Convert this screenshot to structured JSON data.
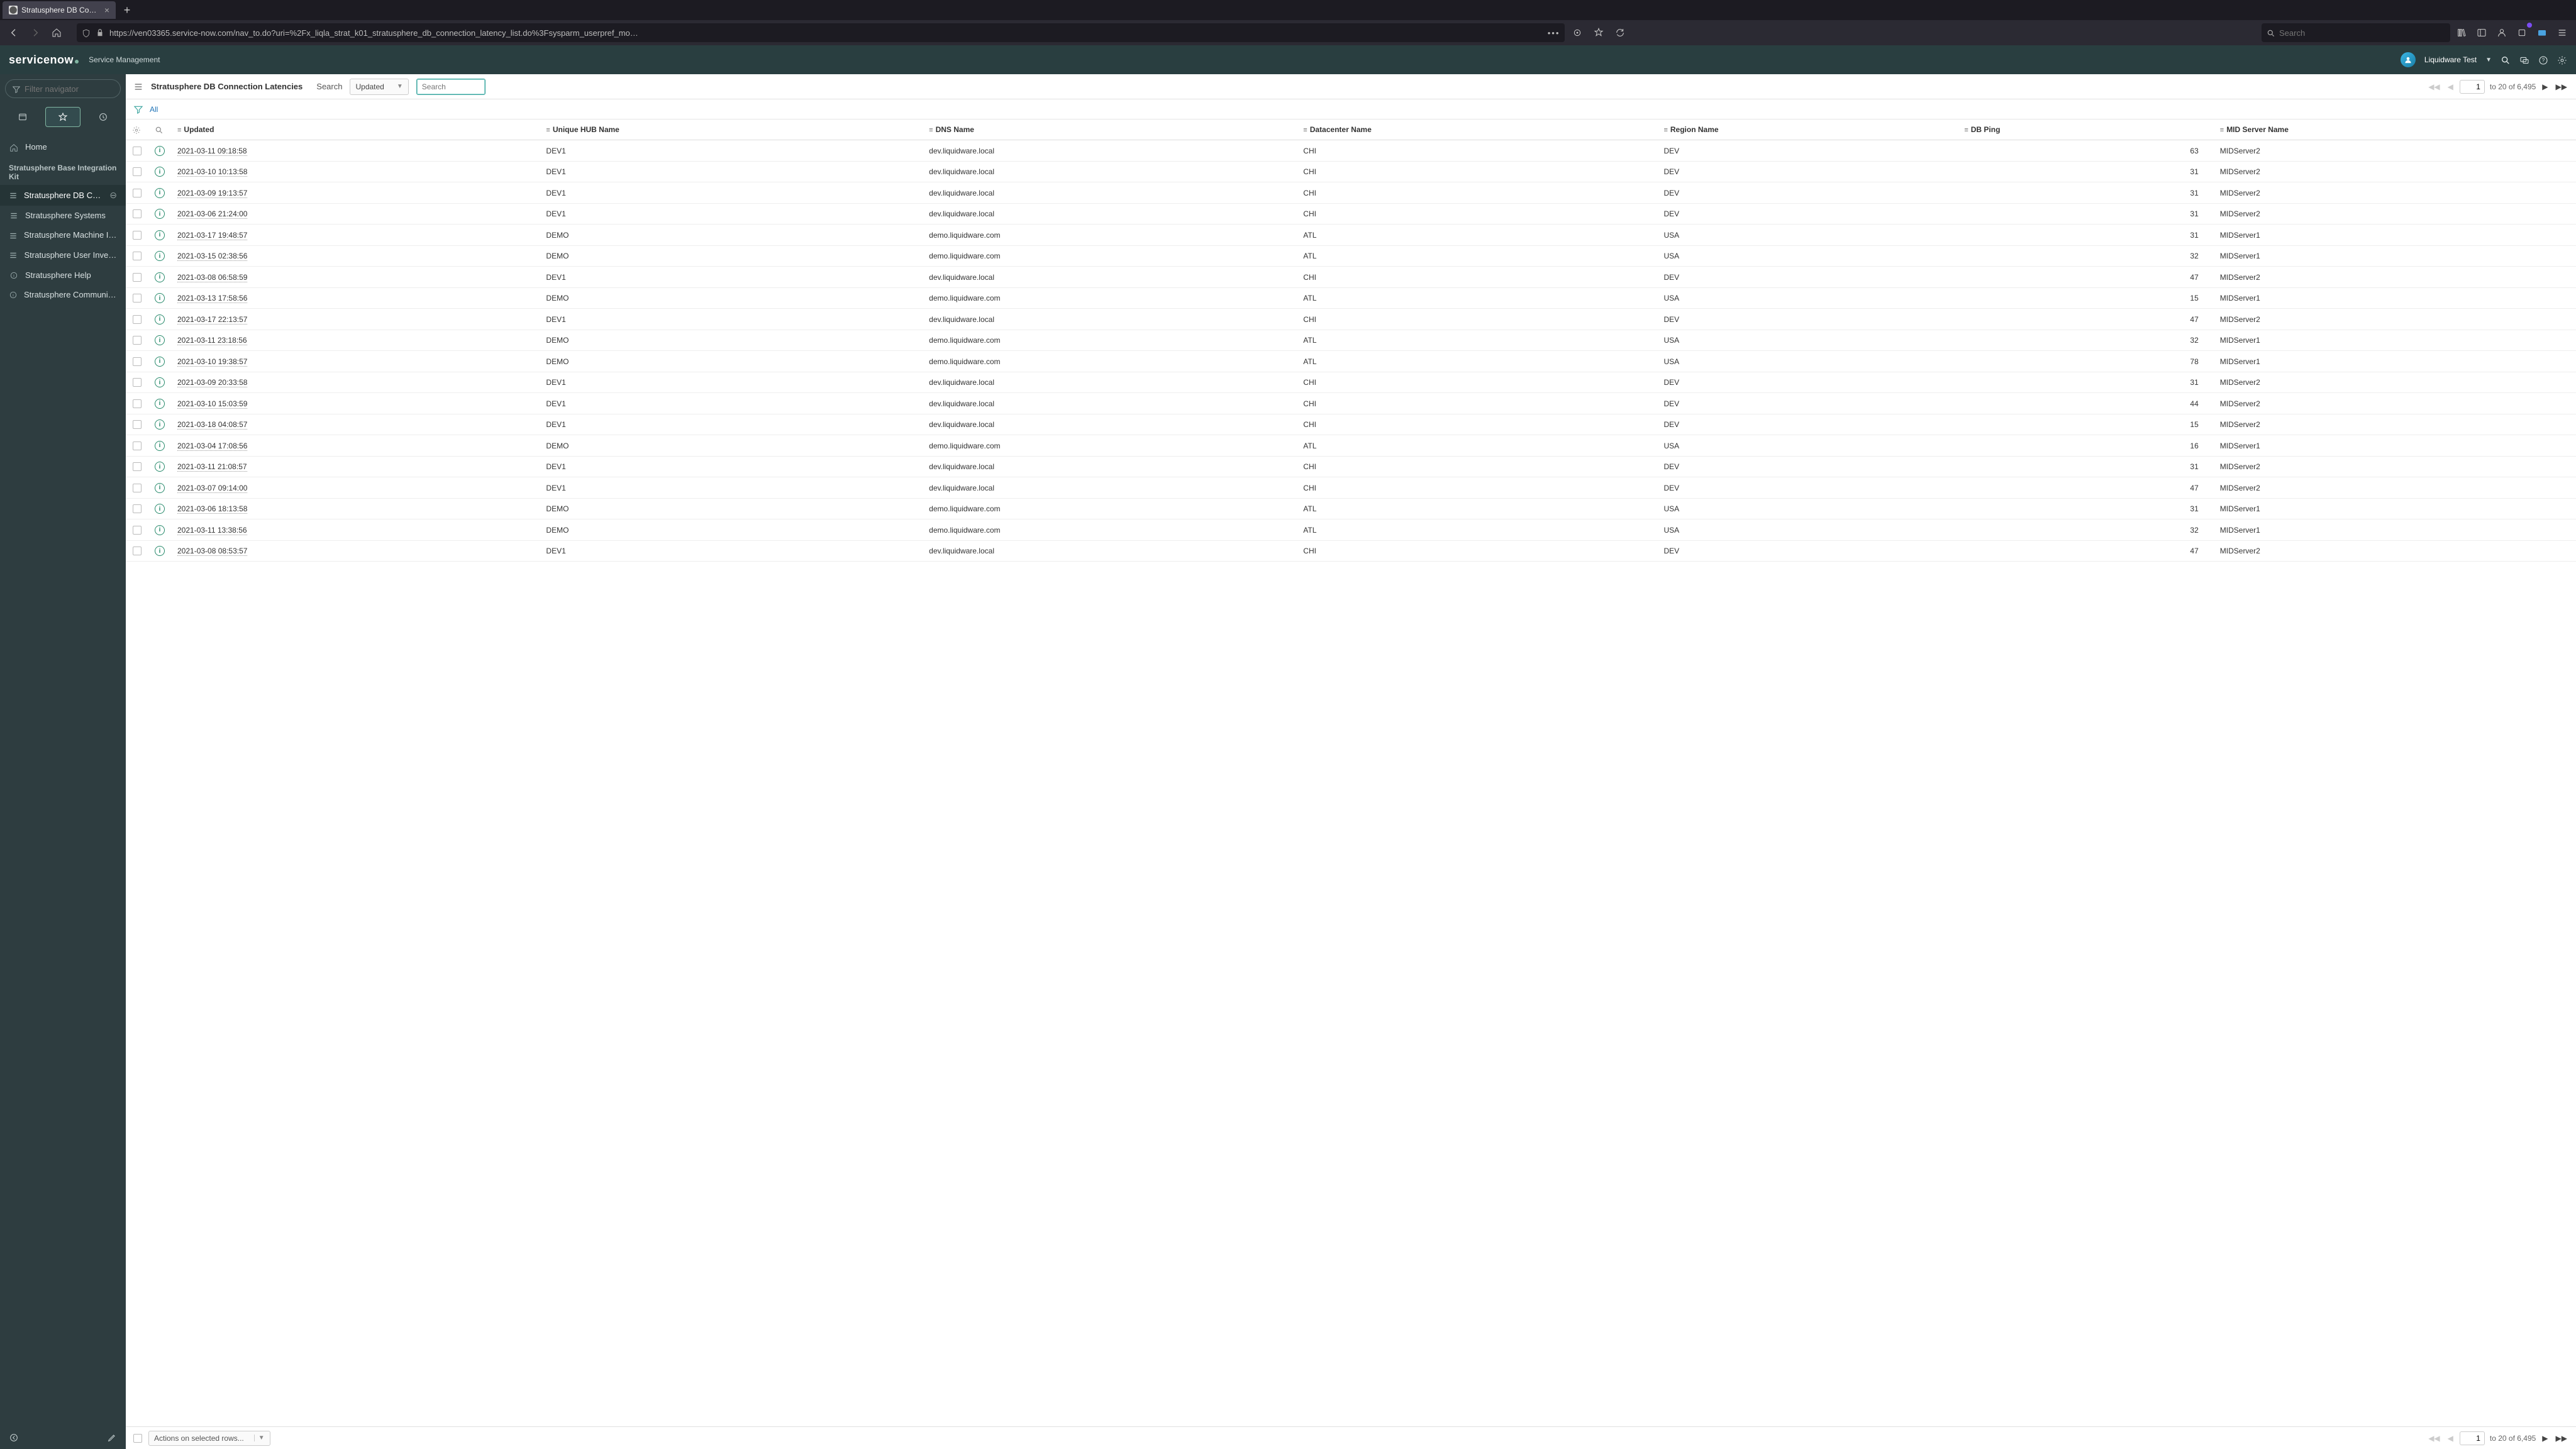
{
  "browser": {
    "tab_title": "Stratusphere DB Connection La…",
    "new_tab": "+",
    "address": "https://ven03365.service-now.com/nav_to.do?uri=%2Fx_liqla_strat_k01_stratusphere_db_connection_latency_list.do%3Fsysparm_userpref_mo…",
    "search_placeholder": "Search"
  },
  "banner": {
    "product": "servicenow",
    "suffix": "Service Management",
    "user": "Liquidware Test"
  },
  "leftnav": {
    "filter_placeholder": "Filter navigator",
    "heading": "Stratusphere Base Integration Kit",
    "home": "Home",
    "items": [
      "Stratusphere DB Connection La…",
      "Stratusphere Systems",
      "Stratusphere Machine Inventory",
      "Stratusphere User Inventory",
      "Stratusphere Help",
      "Stratusphere Community Site"
    ]
  },
  "list": {
    "title": "Stratusphere DB Connection Latencies",
    "search_label": "Search",
    "search_field_selected": "Updated",
    "search_placeholder": "Search",
    "page_input": "1",
    "page_range": "to 20 of 6,495",
    "crumb_all": "All",
    "actions_label": "Actions on selected rows..."
  },
  "columns": [
    "Updated",
    "Unique HUB Name",
    "DNS Name",
    "Datacenter Name",
    "Region Name",
    "DB Ping",
    "MID Server Name"
  ],
  "rows": [
    {
      "updated": "2021-03-11 09:18:58",
      "hub": "DEV1",
      "dns": "dev.liquidware.local",
      "dc": "CHI",
      "region": "DEV",
      "ping": "63",
      "mid": "MIDServer2"
    },
    {
      "updated": "2021-03-10 10:13:58",
      "hub": "DEV1",
      "dns": "dev.liquidware.local",
      "dc": "CHI",
      "region": "DEV",
      "ping": "31",
      "mid": "MIDServer2"
    },
    {
      "updated": "2021-03-09 19:13:57",
      "hub": "DEV1",
      "dns": "dev.liquidware.local",
      "dc": "CHI",
      "region": "DEV",
      "ping": "31",
      "mid": "MIDServer2"
    },
    {
      "updated": "2021-03-06 21:24:00",
      "hub": "DEV1",
      "dns": "dev.liquidware.local",
      "dc": "CHI",
      "region": "DEV",
      "ping": "31",
      "mid": "MIDServer2"
    },
    {
      "updated": "2021-03-17 19:48:57",
      "hub": "DEMO",
      "dns": "demo.liquidware.com",
      "dc": "ATL",
      "region": "USA",
      "ping": "31",
      "mid": "MIDServer1"
    },
    {
      "updated": "2021-03-15 02:38:56",
      "hub": "DEMO",
      "dns": "demo.liquidware.com",
      "dc": "ATL",
      "region": "USA",
      "ping": "32",
      "mid": "MIDServer1"
    },
    {
      "updated": "2021-03-08 06:58:59",
      "hub": "DEV1",
      "dns": "dev.liquidware.local",
      "dc": "CHI",
      "region": "DEV",
      "ping": "47",
      "mid": "MIDServer2"
    },
    {
      "updated": "2021-03-13 17:58:56",
      "hub": "DEMO",
      "dns": "demo.liquidware.com",
      "dc": "ATL",
      "region": "USA",
      "ping": "15",
      "mid": "MIDServer1"
    },
    {
      "updated": "2021-03-17 22:13:57",
      "hub": "DEV1",
      "dns": "dev.liquidware.local",
      "dc": "CHI",
      "region": "DEV",
      "ping": "47",
      "mid": "MIDServer2"
    },
    {
      "updated": "2021-03-11 23:18:56",
      "hub": "DEMO",
      "dns": "demo.liquidware.com",
      "dc": "ATL",
      "region": "USA",
      "ping": "32",
      "mid": "MIDServer1"
    },
    {
      "updated": "2021-03-10 19:38:57",
      "hub": "DEMO",
      "dns": "demo.liquidware.com",
      "dc": "ATL",
      "region": "USA",
      "ping": "78",
      "mid": "MIDServer1"
    },
    {
      "updated": "2021-03-09 20:33:58",
      "hub": "DEV1",
      "dns": "dev.liquidware.local",
      "dc": "CHI",
      "region": "DEV",
      "ping": "31",
      "mid": "MIDServer2"
    },
    {
      "updated": "2021-03-10 15:03:59",
      "hub": "DEV1",
      "dns": "dev.liquidware.local",
      "dc": "CHI",
      "region": "DEV",
      "ping": "44",
      "mid": "MIDServer2"
    },
    {
      "updated": "2021-03-18 04:08:57",
      "hub": "DEV1",
      "dns": "dev.liquidware.local",
      "dc": "CHI",
      "region": "DEV",
      "ping": "15",
      "mid": "MIDServer2"
    },
    {
      "updated": "2021-03-04 17:08:56",
      "hub": "DEMO",
      "dns": "demo.liquidware.com",
      "dc": "ATL",
      "region": "USA",
      "ping": "16",
      "mid": "MIDServer1"
    },
    {
      "updated": "2021-03-11 21:08:57",
      "hub": "DEV1",
      "dns": "dev.liquidware.local",
      "dc": "CHI",
      "region": "DEV",
      "ping": "31",
      "mid": "MIDServer2"
    },
    {
      "updated": "2021-03-07 09:14:00",
      "hub": "DEV1",
      "dns": "dev.liquidware.local",
      "dc": "CHI",
      "region": "DEV",
      "ping": "47",
      "mid": "MIDServer2"
    },
    {
      "updated": "2021-03-06 18:13:58",
      "hub": "DEMO",
      "dns": "demo.liquidware.com",
      "dc": "ATL",
      "region": "USA",
      "ping": "31",
      "mid": "MIDServer1"
    },
    {
      "updated": "2021-03-11 13:38:56",
      "hub": "DEMO",
      "dns": "demo.liquidware.com",
      "dc": "ATL",
      "region": "USA",
      "ping": "32",
      "mid": "MIDServer1"
    },
    {
      "updated": "2021-03-08 08:53:57",
      "hub": "DEV1",
      "dns": "dev.liquidware.local",
      "dc": "CHI",
      "region": "DEV",
      "ping": "47",
      "mid": "MIDServer2"
    }
  ]
}
